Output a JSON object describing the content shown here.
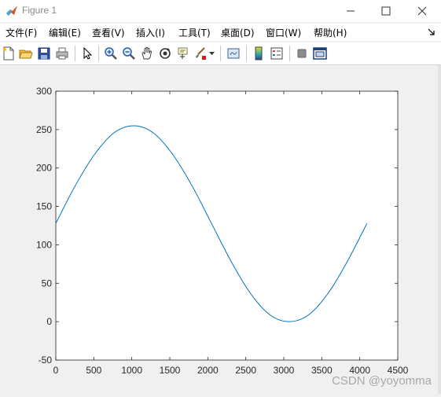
{
  "window": {
    "title": "Figure 1",
    "minimize_label": "—",
    "maximize_label": "☐",
    "close_label": "✕"
  },
  "menu": [
    {
      "label": "文件(F)"
    },
    {
      "label": "编辑(E)"
    },
    {
      "label": "查看(V)"
    },
    {
      "label": "插入(I)"
    },
    {
      "label": "工具(T)"
    },
    {
      "label": "桌面(D)"
    },
    {
      "label": "窗口(W)"
    },
    {
      "label": "帮助(H)"
    }
  ],
  "menu_extra_icon": "dock-arrow-icon",
  "toolbar_icons": [
    "new-figure-icon",
    "open-file-icon",
    "save-icon",
    "print-icon",
    "edit-plot-pointer-icon",
    "zoom-in-icon",
    "zoom-out-icon",
    "pan-hand-icon",
    "rotate-3d-icon",
    "data-cursor-icon",
    "brush-icon",
    "brush-dropdown-icon",
    "link-plot-icon",
    "colorbar-icon",
    "legend-icon",
    "hide-plot-tools-icon",
    "show-plot-tools-icon"
  ],
  "colors": {
    "line": "#0072bd",
    "axes_bg": "#ffffff",
    "figure_bg": "#f0f0f0",
    "close_hover": "#e81123"
  },
  "watermark": "CSDN @yoyomma",
  "chart_data": {
    "type": "line",
    "title": "",
    "xlabel": "",
    "ylabel": "",
    "xlim": [
      0,
      4500
    ],
    "ylim": [
      -50,
      300
    ],
    "xticks": [
      0,
      500,
      1000,
      1500,
      2000,
      2500,
      3000,
      3500,
      4000,
      4500
    ],
    "yticks": [
      -50,
      0,
      50,
      100,
      150,
      200,
      250,
      300
    ],
    "grid": false,
    "series": [
      {
        "x": [
          0,
          256,
          512,
          768,
          1024,
          1280,
          1536,
          1792,
          2048,
          2304,
          2560,
          2816,
          3072,
          3328,
          3584,
          3840,
          4095
        ],
        "y": [
          128,
          177,
          218,
          246,
          255,
          246,
          218,
          177,
          128,
          79,
          37,
          9,
          0,
          9,
          37,
          79,
          128
        ]
      }
    ]
  }
}
